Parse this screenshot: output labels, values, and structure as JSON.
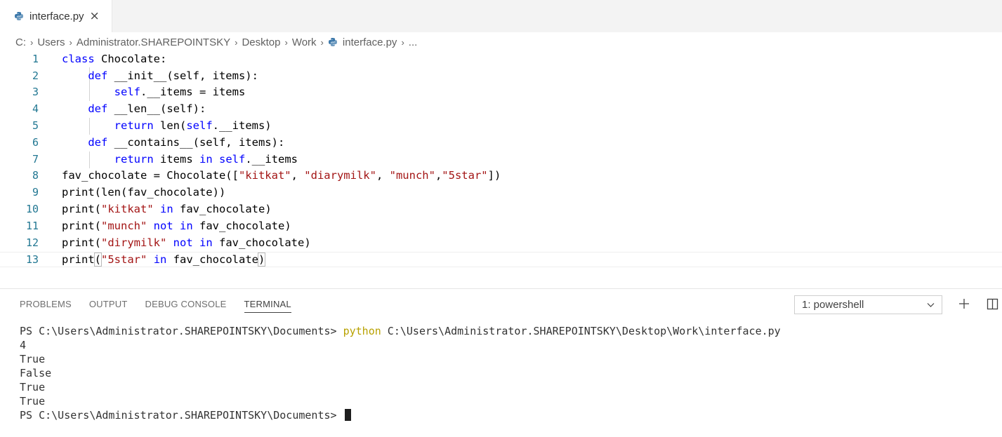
{
  "tab": {
    "label": "interface.py",
    "close": "×",
    "icon": "python-file-icon"
  },
  "breadcrumb": {
    "items": [
      "C:",
      "Users",
      "Administrator.SHAREPOINTSKY",
      "Desktop",
      "Work",
      "interface.py",
      "..."
    ],
    "separator": "›"
  },
  "editor": {
    "line_numbers": [
      "1",
      "2",
      "3",
      "4",
      "5",
      "6",
      "7",
      "8",
      "9",
      "10",
      "11",
      "12",
      "13"
    ]
  },
  "panel": {
    "tabs": [
      "PROBLEMS",
      "OUTPUT",
      "DEBUG CONSOLE",
      "TERMINAL"
    ],
    "active_tab": "TERMINAL",
    "terminal_select": "1: powershell"
  },
  "terminal": {
    "prompt": "PS C:\\Users\\Administrator.SHAREPOINTSKY\\Documents> ",
    "command": "python",
    "command_arg": " C:\\Users\\Administrator.SHAREPOINTSKY\\Desktop\\Work\\interface.py",
    "outputs": [
      "4",
      "True",
      "False",
      "True",
      "True"
    ],
    "final_prompt": "PS C:\\Users\\Administrator.SHAREPOINTSKY\\Documents> "
  },
  "colors": {
    "keyword": "#0000ff",
    "string": "#a31515",
    "line_number": "#237893",
    "python_cmd": "#b8a100"
  }
}
